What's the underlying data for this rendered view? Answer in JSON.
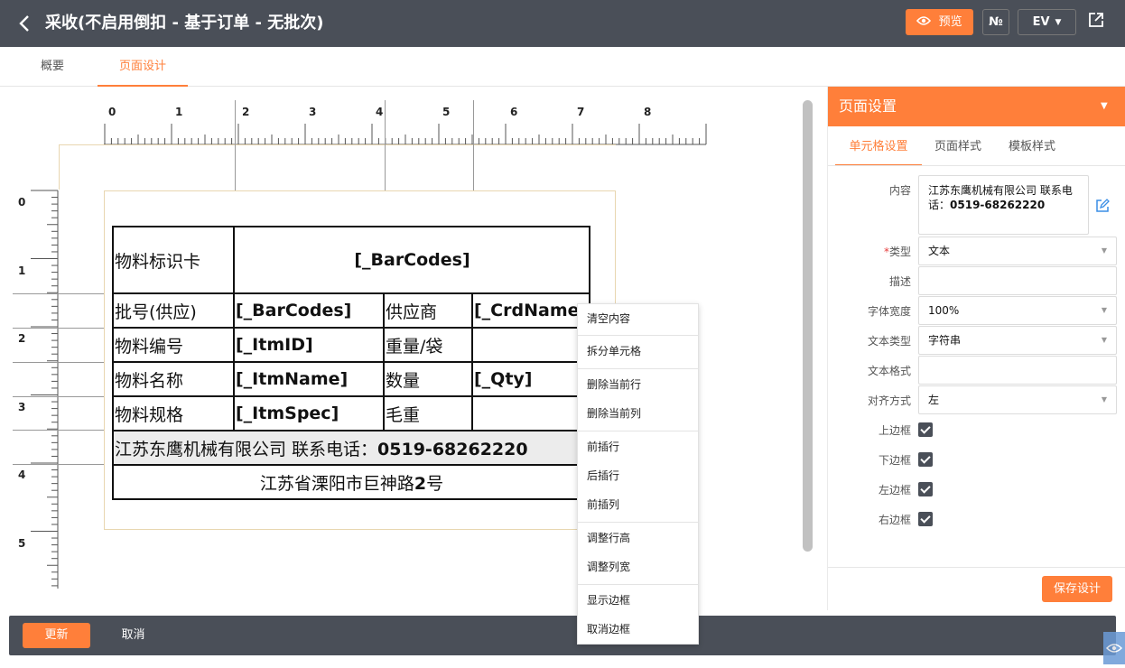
{
  "header": {
    "back_icon": "chevron-left-icon",
    "title": "采收(不启用倒扣 - 基于订单 - 无批次)",
    "preview_label": "预览",
    "numero_label": "№",
    "ev_label": "EV",
    "export_icon": "export-icon",
    "accent_color": "#ff7f3a",
    "bar_color": "#4a4f58"
  },
  "tabs": [
    {
      "label": "概要"
    },
    {
      "label": "页面设计"
    }
  ],
  "ruler": {
    "top": [
      "0",
      "1",
      "2",
      "3",
      "4",
      "5",
      "6",
      "7",
      "8"
    ],
    "left": [
      "0",
      "1",
      "2",
      "3",
      "4",
      "5"
    ]
  },
  "label_table": {
    "title": "物料标识卡",
    "title_value": "[_BarCodes]",
    "rows": [
      [
        "批号(供应)",
        "[_BarCodes]",
        "供应商",
        "[_CrdName]"
      ],
      [
        "物料编号",
        "[_ItmID]",
        "重量/袋",
        ""
      ],
      [
        "物料名称",
        "[_ItmName]",
        "数量",
        "[_Qty]"
      ],
      [
        "物料规格",
        "[_ItmSpec]",
        "毛重",
        ""
      ]
    ],
    "company_prefix": "江苏东鹰机械有限公司 联系电话：",
    "company_phone": "0519-68262220",
    "address_prefix": "江苏省溧阳市巨神路",
    "address_num": "2",
    "address_suffix": "号"
  },
  "context_menu": {
    "items": [
      "清空内容",
      "拆分单元格",
      "删除当前行",
      "删除当前列",
      "前插行",
      "后插行",
      "前插列",
      "调整行高",
      "调整列宽",
      "显示边框",
      "取消边框"
    ]
  },
  "panel": {
    "title": "页面设置",
    "tabs": [
      "单元格设置",
      "页面样式",
      "模板样式"
    ],
    "content_label": "内容",
    "content_prefix": "江苏东鹰机械有限公司 联系电话：",
    "content_phone": "0519-68262220",
    "type_required": "*",
    "type_label": "类型",
    "type_value": "文本",
    "desc_label": "描述",
    "desc_value": "",
    "font_width_label": "字体宽度",
    "font_width_value": "100%",
    "text_type_label": "文本类型",
    "text_type_value": "字符串",
    "text_format_label": "文本格式",
    "text_format_value": "",
    "align_label": "对齐方式",
    "align_value": "左",
    "border_top_label": "上边框",
    "border_bottom_label": "下边框",
    "border_left_label": "左边框",
    "border_right_label": "右边框",
    "border_top": true,
    "border_bottom": true,
    "border_left": true,
    "border_right": true,
    "save_label": "保存设计"
  },
  "footer": {
    "update_label": "更新",
    "cancel_label": "取消"
  }
}
